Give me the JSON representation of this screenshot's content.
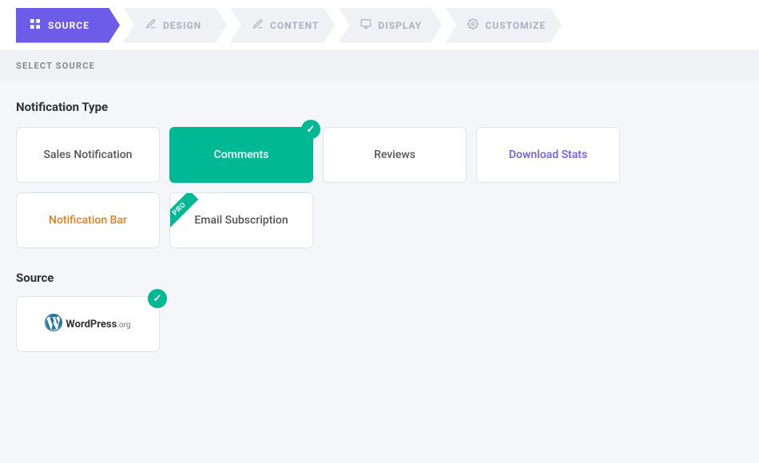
{
  "steps": [
    {
      "id": "source",
      "label": "SOURCE",
      "icon": "☰",
      "active": true
    },
    {
      "id": "design",
      "label": "DESIGN",
      "icon": "✂",
      "active": false
    },
    {
      "id": "content",
      "label": "CONTENT",
      "icon": "✏",
      "active": false
    },
    {
      "id": "display",
      "label": "DISPLAY",
      "icon": "🖥",
      "active": false
    },
    {
      "id": "customize",
      "label": "CUSTOMIZE",
      "icon": "⚙",
      "active": false
    }
  ],
  "section_header": "SELECT SOURCE",
  "notification_type_heading": "Notification Type",
  "source_heading": "Source",
  "notification_types": [
    {
      "id": "sales",
      "label": "Sales Notification",
      "active": false,
      "pro": false,
      "checked": false,
      "color_class": ""
    },
    {
      "id": "comments",
      "label": "Comments",
      "active": true,
      "pro": false,
      "checked": true,
      "color_class": "active"
    },
    {
      "id": "reviews",
      "label": "Reviews",
      "active": false,
      "pro": false,
      "checked": false,
      "color_class": ""
    },
    {
      "id": "download-stats",
      "label": "Download Stats",
      "active": false,
      "pro": false,
      "checked": false,
      "color_class": ""
    },
    {
      "id": "notification-bar",
      "label": "Notification Bar",
      "active": false,
      "pro": false,
      "checked": false,
      "color_class": "pro-label"
    },
    {
      "id": "email-subscription",
      "label": "Email Subscription",
      "active": false,
      "pro": true,
      "checked": false,
      "color_class": ""
    }
  ],
  "source": {
    "label": "WordPress",
    "suffix": ".org",
    "checked": true
  }
}
